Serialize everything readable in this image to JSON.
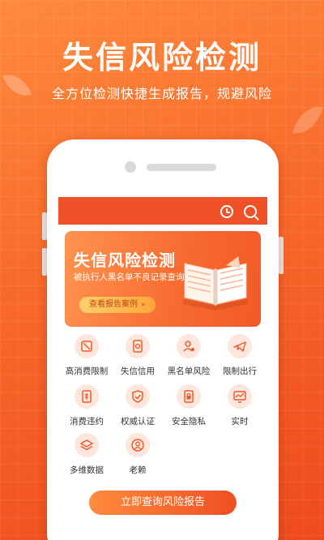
{
  "hero": {
    "title": "失信风险检测",
    "subtitle": "全方位检测快捷生成报告，规避风险"
  },
  "app": {
    "topbar": {
      "icons": [
        "clock-icon",
        "search-icon"
      ]
    },
    "banner": {
      "title": "失信风险检测",
      "subtitle": "被执行人黑名单不良记录查询",
      "button_label": "查看报告案例",
      "button_chevron": "»"
    },
    "features": [
      {
        "label": "高消费限制",
        "icon": "restriction-icon"
      },
      {
        "label": "失信信用",
        "icon": "credit-doc-icon"
      },
      {
        "label": "黑名单风险",
        "icon": "person-alert-icon"
      },
      {
        "label": "限制出行",
        "icon": "plane-icon"
      },
      {
        "label": "消费违约",
        "icon": "receipt-icon"
      },
      {
        "label": "权威认证",
        "icon": "shield-check-icon"
      },
      {
        "label": "安全隐私",
        "icon": "lock-doc-icon"
      },
      {
        "label": "实时",
        "icon": "monitor-icon"
      },
      {
        "label": "多维数据",
        "icon": "layers-icon"
      },
      {
        "label": "老赖",
        "icon": "person-circle-icon"
      }
    ],
    "cta_label": "立即查询风险报告"
  },
  "colors": {
    "brand": "#ef5228",
    "icon_bg": "#fde6dc",
    "icon_stroke": "#ef5a2a"
  }
}
